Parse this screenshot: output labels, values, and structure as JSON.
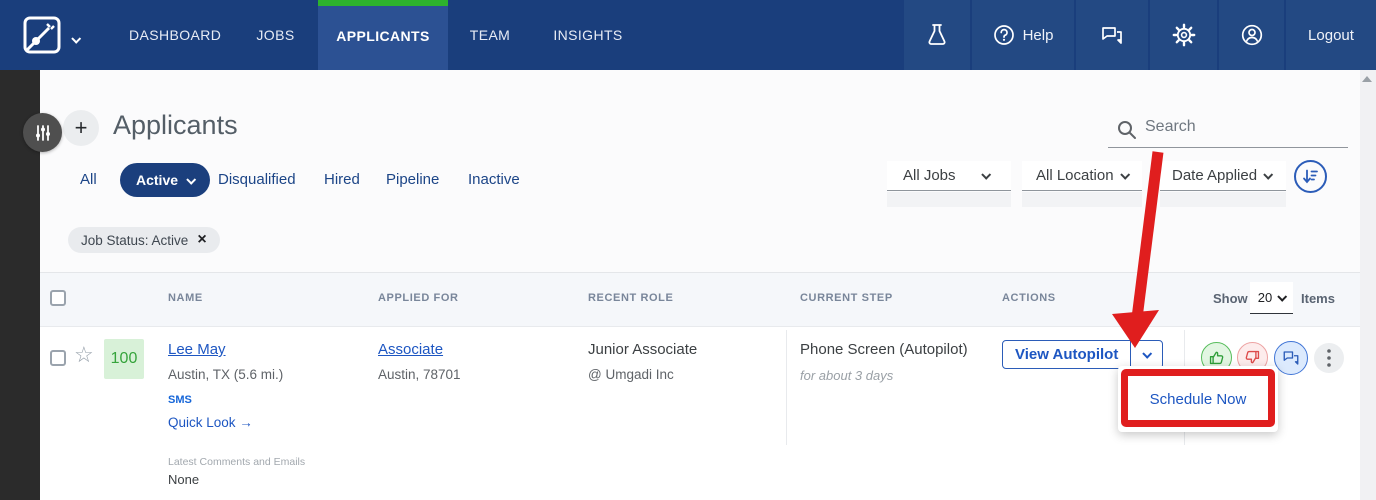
{
  "colors": {
    "navy": "#1a3e7c",
    "navy_active_tab": "#2c5193",
    "accent_green": "#2db32d",
    "link_blue": "#1d56c2",
    "annotation_red": "#e01e1e",
    "score_green": "#36a43c",
    "score_bg": "#d8f1d8"
  },
  "nav": {
    "items": [
      {
        "label": "DASHBOARD",
        "active": false
      },
      {
        "label": "JOBS",
        "active": false
      },
      {
        "label": "APPLICANTS",
        "active": true
      },
      {
        "label": "TEAM",
        "active": false
      },
      {
        "label": "INSIGHTS",
        "active": false
      }
    ],
    "help_label": "Help",
    "logout_label": "Logout",
    "right_icons": [
      "flask-icon",
      "help-icon",
      "chat-icon",
      "gear-icon",
      "account-icon"
    ]
  },
  "page": {
    "title": "Applicants",
    "add_button": "+",
    "search_placeholder": "Search"
  },
  "status_tabs": {
    "all": "All",
    "active": "Active",
    "disqualified": "Disqualified",
    "hired": "Hired",
    "pipeline": "Pipeline",
    "inactive": "Inactive",
    "selected": "Active"
  },
  "filters": {
    "jobs": "All Jobs",
    "location": "All Location",
    "date": "Date Applied"
  },
  "filter_tag": {
    "label": "Job Status: Active",
    "close": "×"
  },
  "table": {
    "columns": {
      "name": "NAME",
      "applied_for": "APPLIED FOR",
      "recent_role": "RECENT ROLE",
      "current_step": "CURRENT STEP",
      "actions": "ACTIONS"
    },
    "pagination": {
      "show": "Show",
      "page_size": "20",
      "items": "Items"
    }
  },
  "applicant": {
    "score": "100",
    "name": "Lee May",
    "location": "Austin, TX (5.6 mi.)",
    "sms": "SMS",
    "quick_look": "Quick Look →",
    "latest_label": "Latest Comments and Emails",
    "latest_value": "None",
    "applied_for": "Associate",
    "applied_location": "Austin, 78701",
    "recent_role": "Junior Associate",
    "recent_company": "@ Umgadi Inc",
    "current_step": "Phone Screen (Autopilot)",
    "step_duration": "for about 3 days",
    "view_autopilot": "View Autopilot"
  },
  "dropdown_menu": {
    "schedule_now": "Schedule Now"
  }
}
